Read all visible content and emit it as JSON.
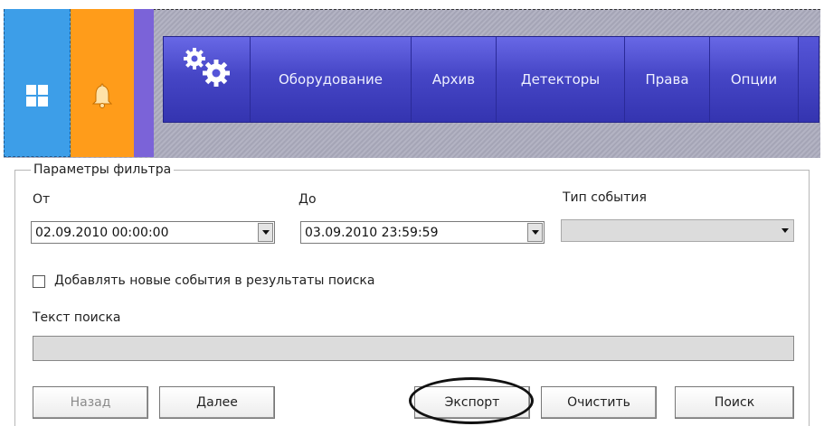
{
  "header": {
    "tiles": [
      {
        "icon": "windows-icon",
        "color": "#3d9ee8"
      },
      {
        "icon": "bell-icon",
        "color": "#ff9c1a"
      },
      {
        "icon": "none",
        "color": "#7b63d8"
      }
    ],
    "nav": {
      "icon": "gears-icon",
      "items": [
        {
          "label": "Оборудование"
        },
        {
          "label": "Архив"
        },
        {
          "label": "Детекторы"
        },
        {
          "label": "Права"
        },
        {
          "label": "Опции"
        }
      ]
    }
  },
  "filter": {
    "legend": "Параметры фильтра",
    "from_label": "От",
    "from_value": "02.09.2010 00:00:00",
    "to_label": "До",
    "to_value": "03.09.2010 23:59:59",
    "event_type_label": "Тип события",
    "event_type_value": "",
    "add_new_events_label": "Добавлять новые события в результаты поиска",
    "add_new_events_checked": false,
    "search_text_label": "Текст поиска",
    "search_text_value": ""
  },
  "buttons": {
    "back": "Назад",
    "next": "Далее",
    "export": "Экспорт",
    "clear": "Очистить",
    "search": "Поиск"
  }
}
